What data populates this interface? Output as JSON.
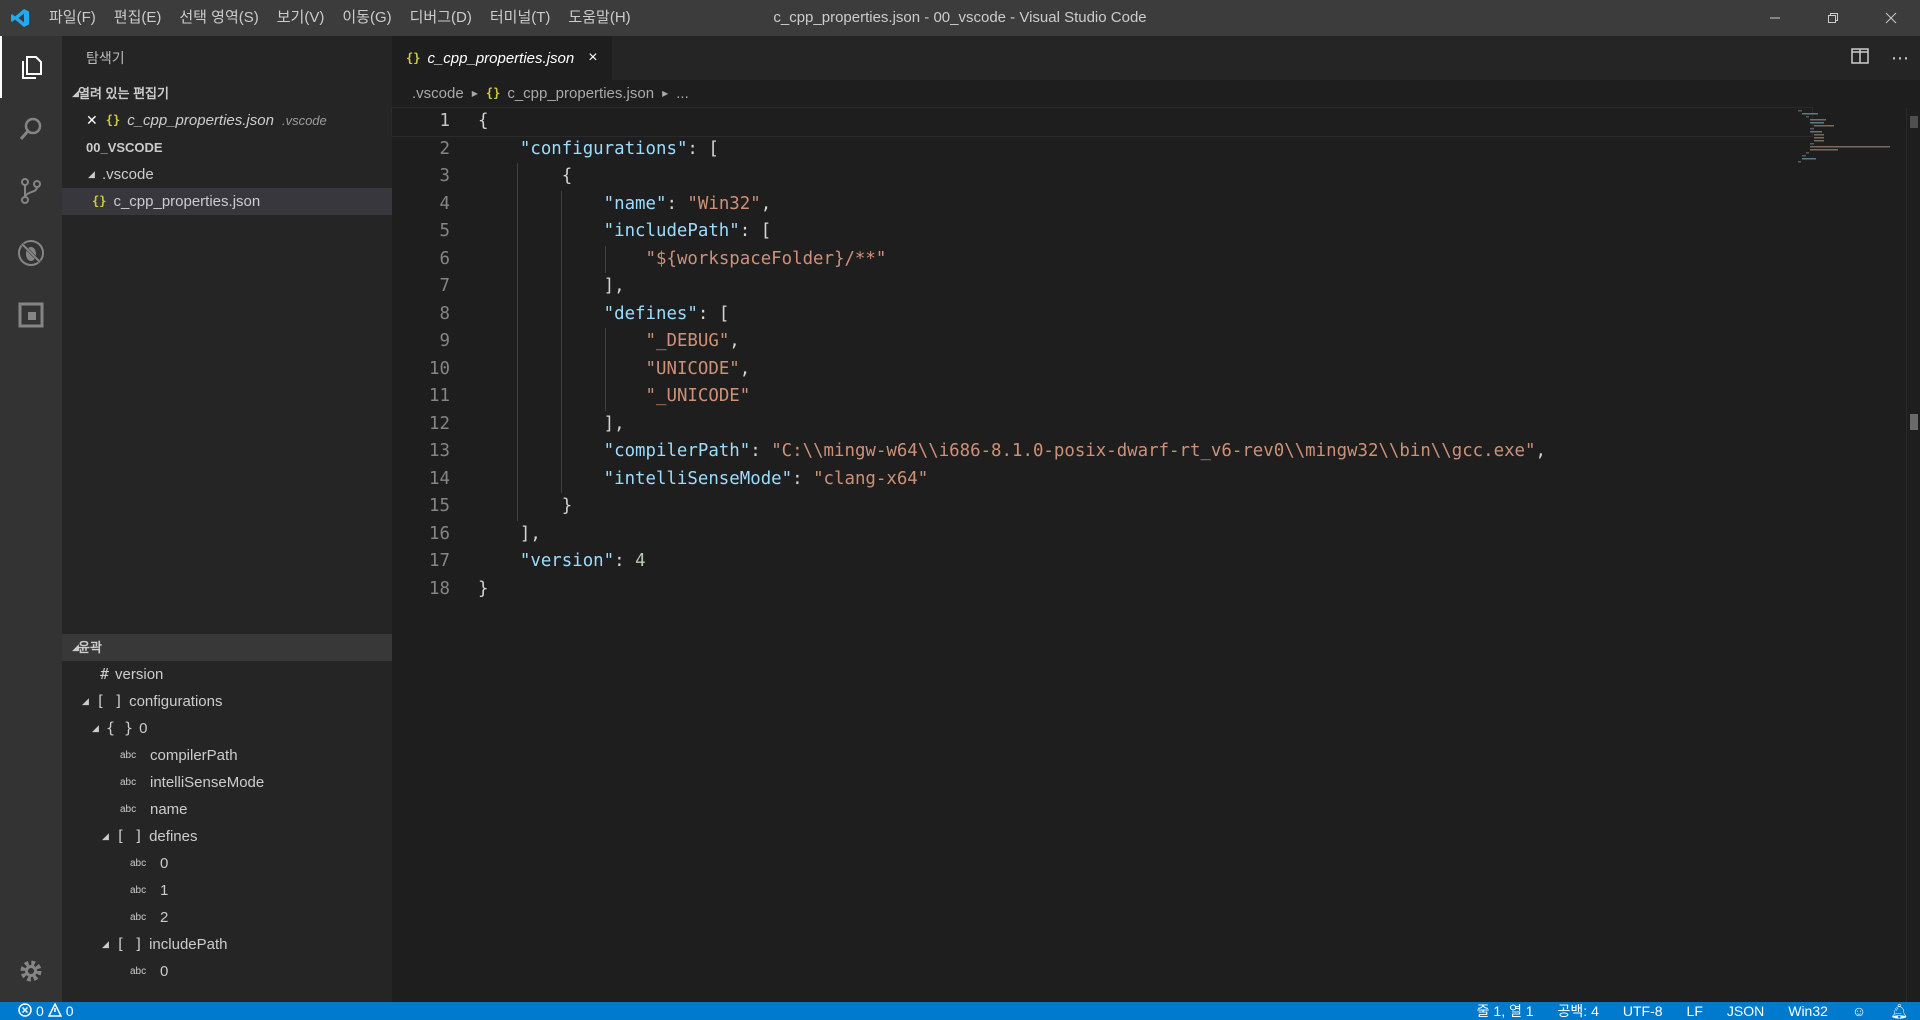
{
  "window": {
    "title": "c_cpp_properties.json - 00_vscode - Visual Studio Code",
    "menu": [
      "파일(F)",
      "편집(E)",
      "선택 영역(S)",
      "보기(V)",
      "이동(G)",
      "디버그(D)",
      "터미널(T)",
      "도움말(H)"
    ],
    "logo_icon": "vscode-logo-icon",
    "controls": [
      "minimize-icon",
      "restore-icon",
      "close-icon"
    ]
  },
  "activity_bar": {
    "items": [
      "explorer-icon",
      "search-icon",
      "source-control-icon",
      "debug-icon",
      "extensions-icon"
    ],
    "settings_icon": "gear-icon"
  },
  "sidebar": {
    "title": "탐색기",
    "open_editors": {
      "header": "열려 있는 편집기",
      "items": [
        {
          "icon": "{}",
          "name": "c_cpp_properties.json",
          "description": ".vscode"
        }
      ]
    },
    "workspace": {
      "header": "00_VSCODE",
      "folder": ".vscode",
      "file_icon": "{}",
      "file": "c_cpp_properties.json"
    },
    "outline": {
      "header": "윤곽",
      "items": [
        {
          "symbol": "#",
          "label": "version"
        },
        {
          "symbol": "[ ]",
          "label": "configurations"
        },
        {
          "symbol": "{ }",
          "label": "0"
        },
        {
          "symbol": "abc",
          "label": "compilerPath"
        },
        {
          "symbol": "abc",
          "label": "intelliSenseMode"
        },
        {
          "symbol": "abc",
          "label": "name"
        },
        {
          "symbol": "[ ]",
          "label": "defines"
        },
        {
          "symbol": "abc",
          "label": "0"
        },
        {
          "symbol": "abc",
          "label": "1"
        },
        {
          "symbol": "abc",
          "label": "2"
        },
        {
          "symbol": "[ ]",
          "label": "includePath"
        },
        {
          "symbol": "abc",
          "label": "0"
        }
      ]
    }
  },
  "editor": {
    "tab": {
      "icon": "{}",
      "label": "c_cpp_properties.json",
      "close": "×"
    },
    "tab_actions": [
      "split-editor-icon",
      "more-actions-icon"
    ],
    "breadcrumb": [
      ".vscode",
      "{}",
      "c_cpp_properties.json",
      "..."
    ],
    "line_numbers": [
      "1",
      "2",
      "3",
      "4",
      "5",
      "6",
      "7",
      "8",
      "9",
      "10",
      "11",
      "12",
      "13",
      "14",
      "15",
      "16",
      "17",
      "18"
    ],
    "code": {
      "l1_brace": "{",
      "configurations_key": "\"configurations\"",
      "colon_bracket": ": [",
      "obj_open": "{",
      "name_key": "\"name\"",
      "name_value": "\"Win32\"",
      "includePath_key": "\"includePath\"",
      "includePath_value": "\"${workspaceFolder}/**\"",
      "close_bracket_comma": "],",
      "defines_key": "\"defines\"",
      "define_0": "\"_DEBUG\"",
      "define_1": "\"UNICODE\"",
      "define_2": "\"_UNICODE\"",
      "compilerPath_key": "\"compilerPath\"",
      "compilerPath_value": "\"C:\\\\mingw-w64\\\\i686-8.1.0-posix-dwarf-rt_v6-rev0\\\\mingw32\\\\bin\\\\gcc.exe\"",
      "intelliSenseMode_key": "\"intelliSenseMode\"",
      "intelliSenseMode_value": "\"clang-x64\"",
      "obj_close": "}",
      "version_key": "\"version\"",
      "version_value": "4",
      "l18_brace": "}",
      "colon": ": ",
      "comma": ","
    }
  },
  "statusbar": {
    "errors": "0",
    "warnings": "0",
    "position": "줄 1, 열 1",
    "spaces": "공백: 4",
    "encoding": "UTF-8",
    "eol": "LF",
    "language": "JSON",
    "config": "Win32",
    "colors": {
      "background": "#007acc"
    }
  }
}
